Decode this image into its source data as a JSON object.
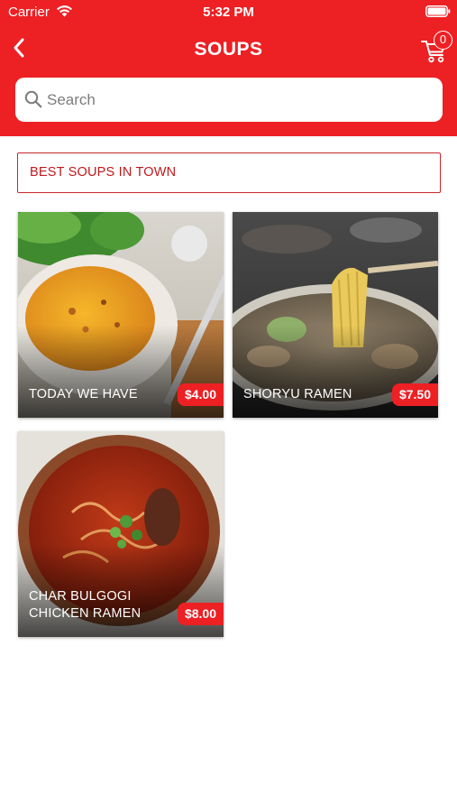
{
  "status_bar": {
    "carrier": "Carrier",
    "time": "5:32 PM"
  },
  "header": {
    "title": "SOUPS",
    "cart_count": "0",
    "back_icon": "chevron-left-icon",
    "cart_icon": "cart-icon"
  },
  "search": {
    "placeholder": "Search",
    "value": ""
  },
  "section": {
    "title": "BEST SOUPS IN TOWN"
  },
  "items": [
    {
      "name": "TODAY WE HAVE",
      "price": "$4.00"
    },
    {
      "name": "SHORYU RAMEN",
      "price": "$7.50"
    },
    {
      "name": "CHAR BULGOGI CHICKEN RAMEN",
      "price": "$8.00"
    }
  ],
  "colors": {
    "brand": "#ed2024",
    "banner_border": "#c8282c"
  }
}
